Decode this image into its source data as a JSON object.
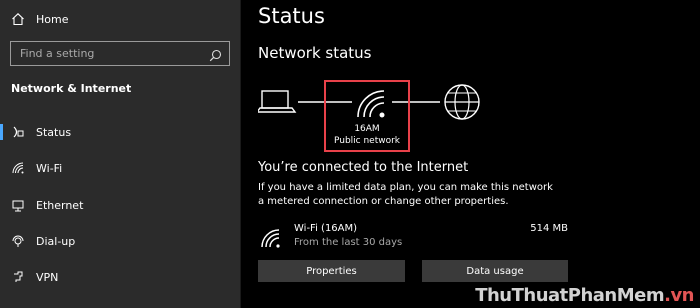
{
  "sidebar": {
    "home_label": "Home",
    "search_placeholder": "Find a setting",
    "section_title": "Network & Internet",
    "items": [
      {
        "label": "Status",
        "icon": "status-icon",
        "selected": true
      },
      {
        "label": "Wi-Fi",
        "icon": "wifi-icon"
      },
      {
        "label": "Ethernet",
        "icon": "ethernet-icon"
      },
      {
        "label": "Dial-up",
        "icon": "dialup-icon"
      },
      {
        "label": "VPN",
        "icon": "vpn-icon"
      }
    ]
  },
  "main": {
    "title": "Status",
    "network_status_heading": "Network status",
    "network": {
      "name": "16AM",
      "type": "Public network"
    },
    "connected_text": "You’re connected to the Internet",
    "description": "If you have a limited data plan, you can make this network a metered connection or change other properties.",
    "usage": {
      "name": "Wi-Fi (16AM)",
      "period": "From the last 30 days",
      "amount": "514 MB"
    },
    "buttons": {
      "properties": "Properties",
      "data_usage": "Data usage"
    }
  },
  "colors": {
    "accent": "#4aa8ff",
    "highlight": "#e8414a",
    "sidebar_bg": "#2b2b2b",
    "main_bg": "#000000"
  },
  "watermark": {
    "text": "ThuThuatPhanMem",
    "suffix": ".vn"
  }
}
